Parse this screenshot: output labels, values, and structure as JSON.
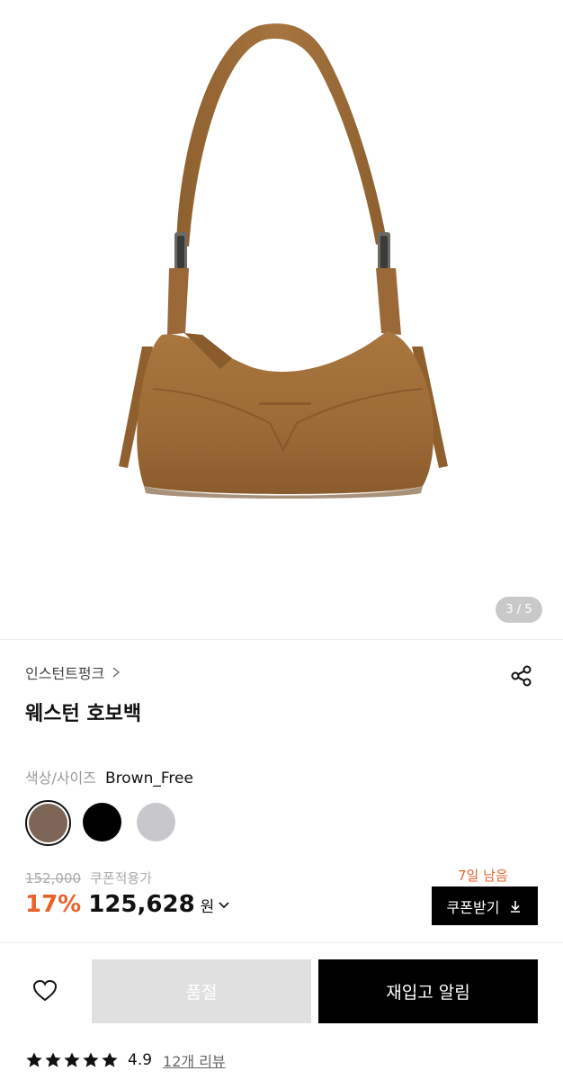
{
  "gallery": {
    "counter": "3 / 5",
    "image_alt": "brown suede hobo bag product image"
  },
  "product": {
    "brand": "인스턴트펑크",
    "title": "웨스턴 호보백"
  },
  "options": {
    "label": "색상/사이즈",
    "value": "Brown_Free",
    "swatches": [
      {
        "name": "brown",
        "color": "#7d6656",
        "selected": true
      },
      {
        "name": "black",
        "color": "#000000",
        "selected": false
      },
      {
        "name": "gray",
        "color": "#c8c8cc",
        "selected": false
      }
    ]
  },
  "pricing": {
    "original_price": "152,000",
    "coupon_applied_label": "쿠폰적용가",
    "discount_rate": "17%",
    "sale_price": "125,628",
    "currency": "원",
    "coupon_days_left": "7일 남음",
    "coupon_button": "쿠폰받기",
    "accent_color": "#e8622c"
  },
  "actions": {
    "sold_out": "품절",
    "restock_alert": "재입고 알림"
  },
  "reviews": {
    "rating": "4.9",
    "review_count": "12개 리뷰"
  }
}
